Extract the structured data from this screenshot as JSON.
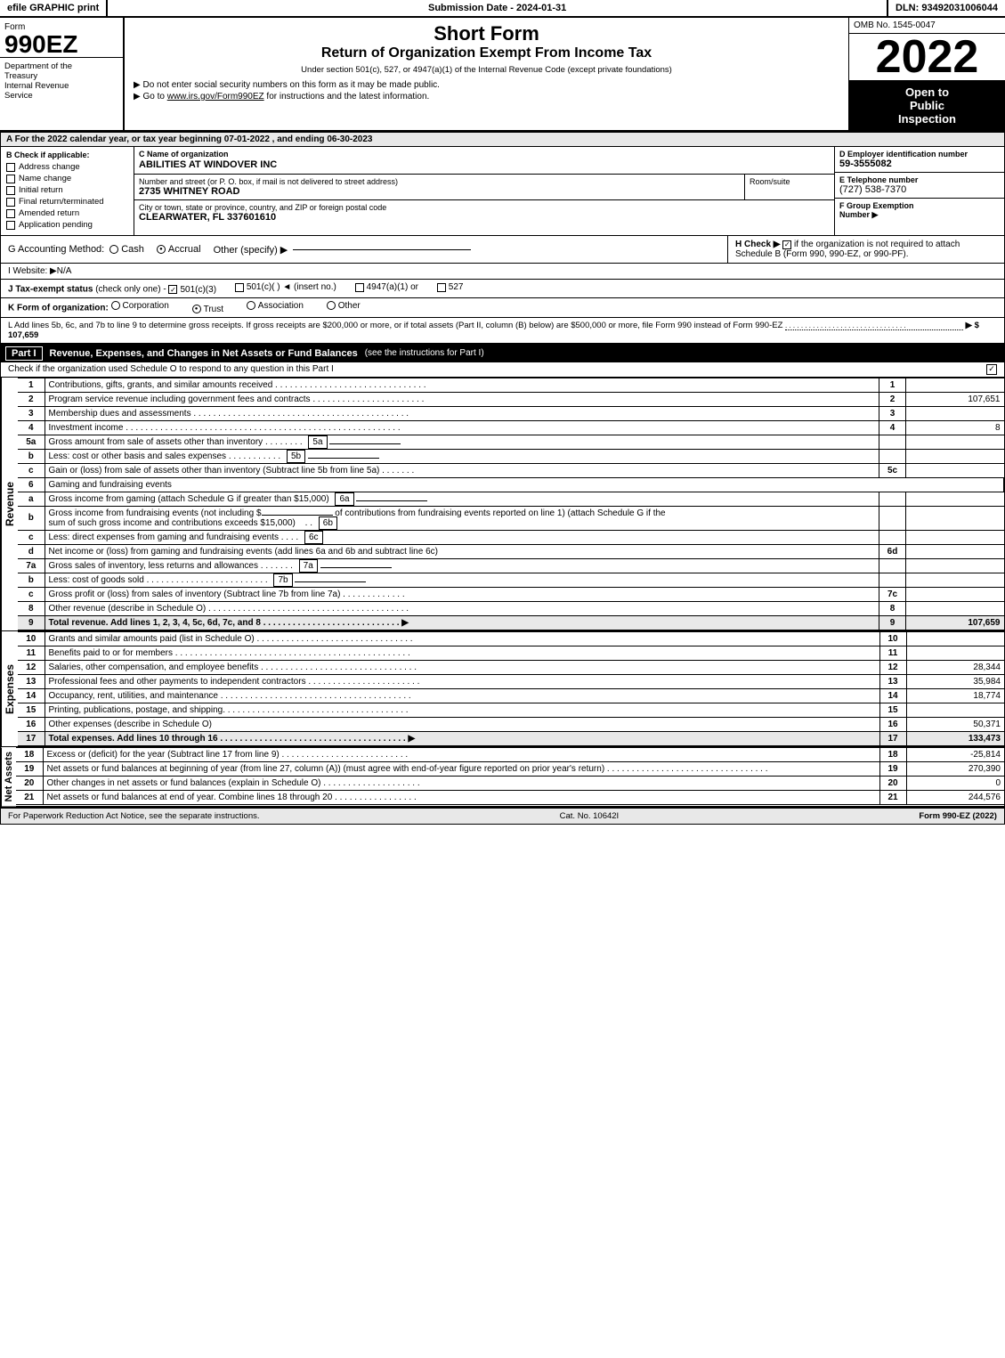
{
  "topBar": {
    "efileLabel": "efile GRAPHIC print",
    "submissionLabel": "Submission Date - 2024-01-31",
    "dlnLabel": "DLN: 93492031006044"
  },
  "formHeader": {
    "formLabel": "Form",
    "form990EZ": "990EZ",
    "deptLine1": "Department of the",
    "deptLine2": "Treasury",
    "deptLine3": "Internal Revenue",
    "deptLine4": "Service",
    "shortFormTitle": "Short Form",
    "returnTitle": "Return of Organization Exempt From Income Tax",
    "underText": "Under section 501(c), 527, or 4947(a)(1) of the Internal Revenue Code (except private foundations)",
    "doNotEnter": "▶ Do not enter social security numbers on this form as it may be made public.",
    "gotoLine": "▶ Go to www.irs.gov/Form990EZ for instructions and the latest information.",
    "ombLabel": "OMB No. 1545-0047",
    "year": "2022",
    "openToPublic": "Open to",
    "publicLabel": "Public",
    "inspectionLabel": "Inspection"
  },
  "sectionA": {
    "label": "A  For the 2022 calendar year, or tax year beginning 07-01-2022 , and ending 06-30-2023"
  },
  "checkApplicable": {
    "label": "B  Check if applicable:",
    "items": [
      {
        "id": "address-change",
        "label": "Address change",
        "checked": false
      },
      {
        "id": "name-change",
        "label": "Name change",
        "checked": false
      },
      {
        "id": "initial-return",
        "label": "Initial return",
        "checked": false
      },
      {
        "id": "final-return",
        "label": "Final return/terminated",
        "checked": false
      },
      {
        "id": "amended-return",
        "label": "Amended return",
        "checked": false
      },
      {
        "id": "application-pending",
        "label": "Application pending",
        "checked": false
      }
    ]
  },
  "orgInfo": {
    "nameLabel": "C  Name of organization",
    "name": "ABILITIES AT WINDOVER INC",
    "addressLabel": "Number and street (or P. O. box, if mail is not delivered to street address)",
    "address": "2735 WHITNEY ROAD",
    "roomLabel": "Room/suite",
    "cityLabel": "City or town, state or province, country, and ZIP or foreign postal code",
    "city": "CLEARWATER, FL  337601610",
    "einLabel": "D  Employer identification number",
    "ein": "59-3555082",
    "phoneLabel": "E  Telephone number",
    "phone": "(727) 538-7370",
    "groupExLabel": "F  Group Exemption",
    "groupExLabel2": "Number",
    "groupExArrow": "▶"
  },
  "accountingMethod": {
    "label": "G  Accounting Method:",
    "cashLabel": "Cash",
    "accrualLabel": "Accrual",
    "accrualChecked": true,
    "otherLabel": "Other (specify) ▶"
  },
  "hCheck": {
    "label": "H  Check ▶",
    "checkLabel": "if the organization is not required to attach Schedule B (Form 990, 990-EZ, or 990-PF).",
    "checked": true
  },
  "website": {
    "label": "I  Website: ▶N/A"
  },
  "taxExempt": {
    "label": "J  Tax-exempt status",
    "checkOnly": "(check only one)",
    "options": [
      {
        "id": "501c3",
        "label": "501(c)(3)",
        "checked": true
      },
      {
        "id": "501c",
        "label": "501(c)(  )  ◄ (insert no.)",
        "checked": false
      },
      {
        "id": "4947",
        "label": "4947(a)(1) or",
        "checked": false
      },
      {
        "id": "527",
        "label": "527",
        "checked": false
      }
    ]
  },
  "formOrg": {
    "label": "K  Form of organization:",
    "options": [
      {
        "id": "corporation",
        "label": "Corporation",
        "checked": false
      },
      {
        "id": "trust",
        "label": "Trust",
        "checked": true
      },
      {
        "id": "association",
        "label": "Association",
        "checked": false
      },
      {
        "id": "other",
        "label": "Other",
        "checked": false
      }
    ]
  },
  "addLines": {
    "label": "L  Add lines 5b, 6c, and 7b to line 9 to determine gross receipts. If gross receipts are $200,000 or more, or if total assets (Part II, column (B) below) are $500,000 or more, file Form 990 instead of Form 990-EZ",
    "amount": "▶ $ 107,659"
  },
  "partI": {
    "label": "Part I",
    "title": "Revenue, Expenses, and Changes in Net Assets or Fund Balances",
    "seeInstructions": "(see the instructions for Part I)",
    "scheduleOCheck": "Check if the organization used Schedule O to respond to any question in this Part I",
    "scheduleOChecked": true,
    "lines": [
      {
        "num": "1",
        "desc": "Contributions, gifts, grants, and similar amounts received",
        "dots": true,
        "lineRef": "1",
        "amount": ""
      },
      {
        "num": "2",
        "desc": "Program service revenue including government fees and contracts",
        "dots": true,
        "lineRef": "2",
        "amount": "107,651"
      },
      {
        "num": "3",
        "desc": "Membership dues and assessments",
        "dots": true,
        "lineRef": "3",
        "amount": ""
      },
      {
        "num": "4",
        "desc": "Investment income",
        "dots": true,
        "lineRef": "4",
        "amount": "8"
      },
      {
        "num": "5a",
        "desc": "Gross amount from sale of assets other than inventory",
        "lineRef": "5a",
        "amount": ""
      },
      {
        "num": "b",
        "desc": "Less: cost or other basis and sales expenses",
        "lineRef": "5b",
        "amount": ""
      },
      {
        "num": "c",
        "desc": "Gain or (loss) from sale of assets other than inventory (Subtract line 5b from line 5a)",
        "dots": true,
        "lineRef": "5c",
        "amount": ""
      },
      {
        "num": "6",
        "desc": "Gaming and fundraising events",
        "lineRef": "",
        "amount": ""
      },
      {
        "num": "a",
        "desc": "Gross income from gaming (attach Schedule G if greater than $15,000)",
        "lineRef": "6a",
        "amount": ""
      },
      {
        "num": "b",
        "desc": "Gross income from fundraising events (not including $_____ of contributions from fundraising events reported on line 1) (attach Schedule G if the sum of such gross income and contributions exceeds $15,000)",
        "lineRef": "6b",
        "amount": ""
      },
      {
        "num": "c",
        "desc": "Less: direct expenses from gaming and fundraising events",
        "lineRef": "6c",
        "amount": ""
      },
      {
        "num": "d",
        "desc": "Net income or (loss) from gaming and fundraising events (add lines 6a and 6b and subtract line 6c)",
        "lineRef": "6d",
        "amount": ""
      },
      {
        "num": "7a",
        "desc": "Gross sales of inventory, less returns and allowances",
        "dots": true,
        "lineRef": "7a",
        "amount": ""
      },
      {
        "num": "b",
        "desc": "Less: cost of goods sold",
        "dots": true,
        "lineRef": "7b",
        "amount": ""
      },
      {
        "num": "c",
        "desc": "Gross profit or (loss) from sales of inventory (Subtract line 7b from line 7a)",
        "dots": true,
        "lineRef": "7c",
        "amount": ""
      },
      {
        "num": "8",
        "desc": "Other revenue (describe in Schedule O)",
        "dots": true,
        "lineRef": "8",
        "amount": ""
      },
      {
        "num": "9",
        "desc": "Total revenue. Add lines 1, 2, 3, 4, 5c, 6d, 7c, and 8",
        "dots": true,
        "bold": true,
        "arrow": true,
        "lineRef": "9",
        "amount": "107,659"
      }
    ]
  },
  "expenses": {
    "lines": [
      {
        "num": "10",
        "desc": "Grants and similar amounts paid (list in Schedule O)",
        "dots": true,
        "lineRef": "10",
        "amount": ""
      },
      {
        "num": "11",
        "desc": "Benefits paid to or for members",
        "dots": true,
        "lineRef": "11",
        "amount": ""
      },
      {
        "num": "12",
        "desc": "Salaries, other compensation, and employee benefits",
        "dots": true,
        "lineRef": "12",
        "amount": "28,344"
      },
      {
        "num": "13",
        "desc": "Professional fees and other payments to independent contractors",
        "dots": true,
        "lineRef": "13",
        "amount": "35,984"
      },
      {
        "num": "14",
        "desc": "Occupancy, rent, utilities, and maintenance",
        "dots": true,
        "lineRef": "14",
        "amount": "18,774"
      },
      {
        "num": "15",
        "desc": "Printing, publications, postage, and shipping",
        "dots": true,
        "lineRef": "15",
        "amount": ""
      },
      {
        "num": "16",
        "desc": "Other expenses (describe in Schedule O)",
        "lineRef": "16",
        "amount": "50,371"
      },
      {
        "num": "17",
        "desc": "Total expenses. Add lines 10 through 16",
        "dots": true,
        "bold": true,
        "arrow": true,
        "lineRef": "17",
        "amount": "133,473"
      }
    ]
  },
  "netAssets": {
    "lines": [
      {
        "num": "18",
        "desc": "Excess or (deficit) for the year (Subtract line 17 from line 9)",
        "dots": true,
        "lineRef": "18",
        "amount": "-25,814"
      },
      {
        "num": "19",
        "desc": "Net assets or fund balances at beginning of year (from line 27, column (A)) (must agree with end-of-year figure reported on prior year's return)",
        "dots": true,
        "lineRef": "19",
        "amount": "270,390"
      },
      {
        "num": "20",
        "desc": "Other changes in net assets or fund balances (explain in Schedule O)",
        "dots": true,
        "lineRef": "20",
        "amount": "0"
      },
      {
        "num": "21",
        "desc": "Net assets or fund balances at end of year. Combine lines 18 through 20",
        "dots": true,
        "lineRef": "21",
        "amount": "244,576"
      }
    ]
  },
  "footer": {
    "paperworkText": "For Paperwork Reduction Act Notice, see the separate instructions.",
    "catNo": "Cat. No. 10642I",
    "formLabel": "Form 990-EZ (2022)"
  }
}
